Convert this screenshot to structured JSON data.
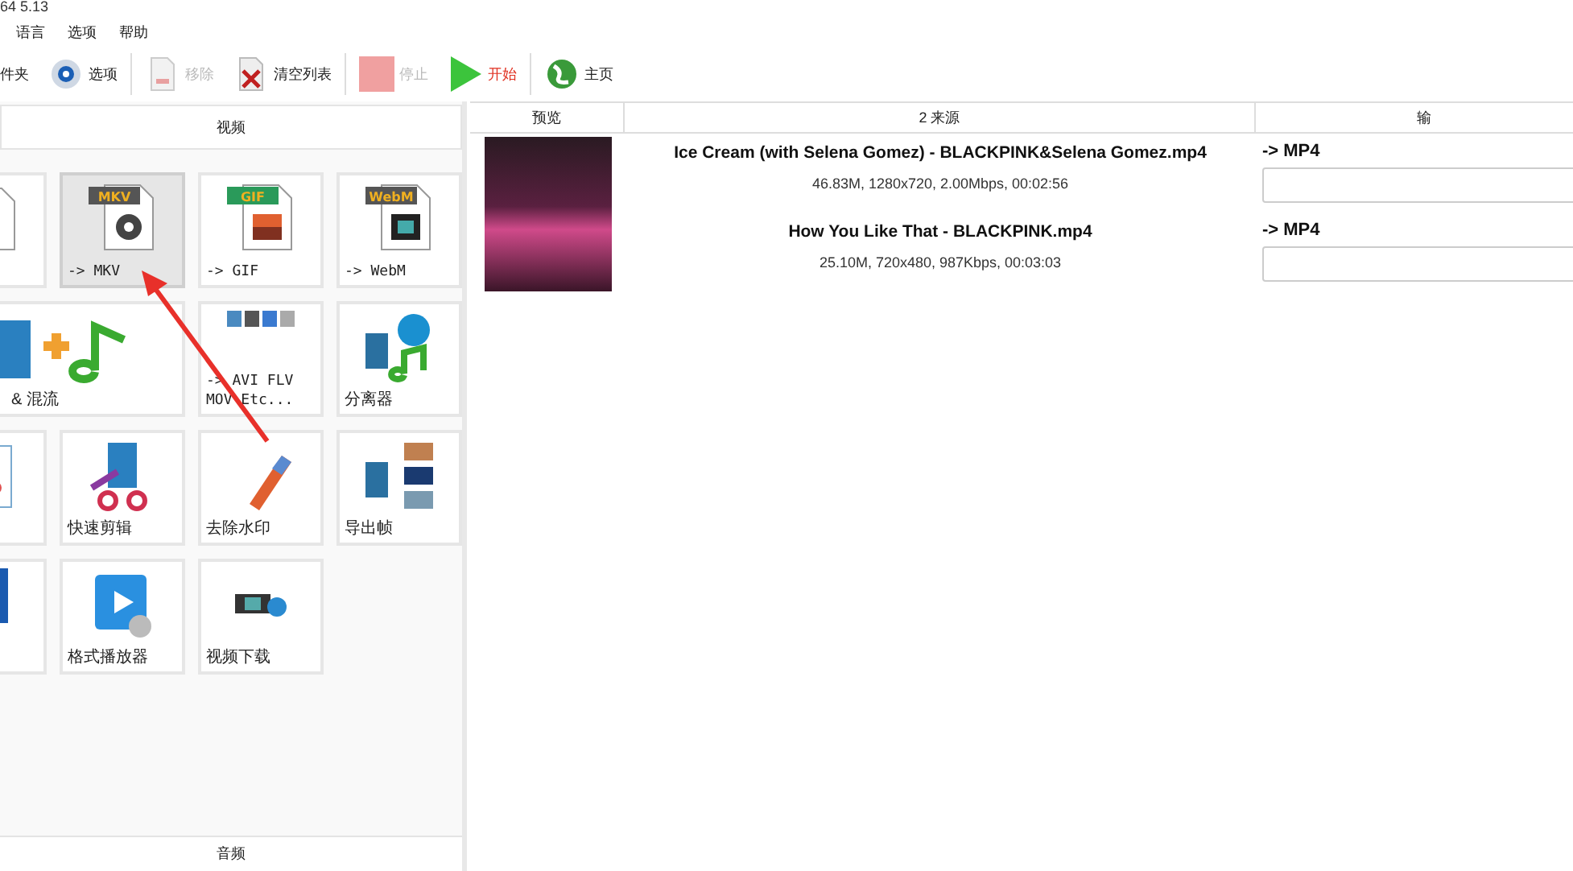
{
  "window": {
    "title": "64 5.13"
  },
  "menu": [
    "语言",
    "选项",
    "帮助"
  ],
  "toolbar": [
    {
      "kind": "folder",
      "label": "件夹",
      "disabled": false
    },
    {
      "kind": "options",
      "label": "选项",
      "disabled": false
    },
    {
      "kind": "remove",
      "label": "移除",
      "disabled": true
    },
    {
      "kind": "clear",
      "label": "清空列表",
      "disabled": false
    },
    {
      "kind": "stop",
      "label": "停止",
      "disabled": true
    },
    {
      "kind": "start",
      "label": "开始",
      "disabled": false
    },
    {
      "kind": "home",
      "label": "主页",
      "disabled": false
    }
  ],
  "panel": {
    "header": "视频",
    "footer_header": "音频",
    "tiles": [
      {
        "kind": "doc",
        "selected": false,
        "wide": false
      },
      {
        "kind": "mkv",
        "badge": "MKV",
        "label": "-> MKV",
        "selected": true,
        "wide": false
      },
      {
        "kind": "gif",
        "badge": "GIF",
        "label": "-> GIF",
        "selected": false,
        "wide": false
      },
      {
        "kind": "webm",
        "badge": "WebM",
        "label": "-> WebM",
        "selected": false,
        "wide": false
      },
      {
        "kind": "mux",
        "label": "& 混流",
        "selected": false,
        "wide": true
      },
      {
        "kind": "formats",
        "label": "-> AVI FLV MOV Etc...",
        "selected": false,
        "wide": false
      },
      {
        "kind": "split",
        "label": "分离器",
        "selected": false,
        "wide": false
      },
      {
        "kind": "crop",
        "selected": false,
        "wide": false
      },
      {
        "kind": "cut",
        "label": "快速剪辑",
        "selected": false,
        "wide": false
      },
      {
        "kind": "logo",
        "label": "去除水印",
        "selected": false,
        "wide": false
      },
      {
        "kind": "frames",
        "label": "导出帧",
        "selected": false,
        "wide": false
      },
      {
        "kind": "screen",
        "selected": false,
        "wide": false
      },
      {
        "kind": "player",
        "label": "格式播放器",
        "selected": false,
        "wide": false
      },
      {
        "kind": "download",
        "label": "视频下载",
        "selected": false,
        "wide": false
      }
    ]
  },
  "table": {
    "columns": [
      "预览",
      "2 来源",
      "输"
    ],
    "rows": [
      {
        "name": "Ice Cream (with Selena Gomez) - BLACKPINK&Selena Gomez.mp4",
        "info": "46.83M, 1280x720, 2.00Mbps, 00:02:56",
        "output": "-> MP4"
      },
      {
        "name": "How You Like That - BLACKPINK.mp4",
        "info": "25.10M, 720x480, 987Kbps, 00:03:03",
        "output": "-> MP4"
      }
    ]
  }
}
